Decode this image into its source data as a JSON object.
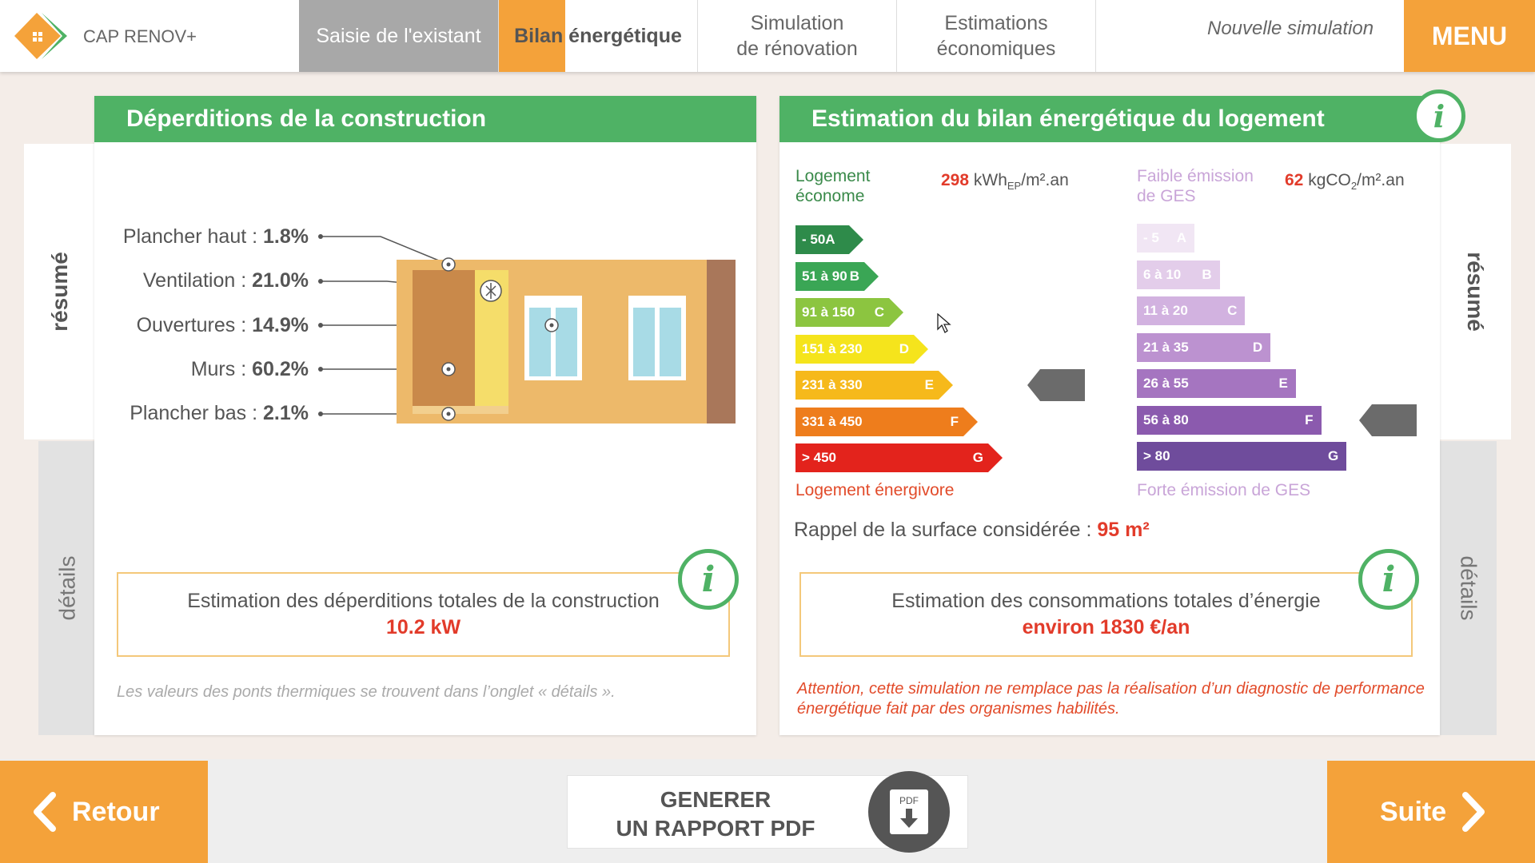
{
  "header": {
    "app_name": "CAP RENOV+",
    "tabs": [
      {
        "label": "Saisie de l'existant"
      },
      {
        "label_highlight": "Bilan",
        "label_rest": " énergétique"
      },
      {
        "line1": "Simulation",
        "line2": "de rénovation"
      },
      {
        "line1": "Estimations",
        "line2": "économiques"
      }
    ],
    "new_simulation": "Nouvelle simulation",
    "menu_label": "MENU"
  },
  "left_panel": {
    "title": "Déperditions de la construction",
    "side_tab_top": "résumé",
    "side_tab_bottom": "détails",
    "losses": [
      {
        "name": "Plancher haut : ",
        "value": "1.8%"
      },
      {
        "name": "Ventilation : ",
        "value": "21.0%"
      },
      {
        "name": "Ouvertures : ",
        "value": "14.9%"
      },
      {
        "name": "Murs : ",
        "value": "60.2%"
      },
      {
        "name": "Plancher bas : ",
        "value": "2.1%"
      }
    ],
    "total_label": "Estimation des déperditions totales de la construction",
    "total_value": "10.2 kW",
    "note": "Les valeurs des ponts thermiques se trouvent dans l’onglet « détails »."
  },
  "right_panel": {
    "title": "Estimation du bilan énergétique du logement",
    "side_tab_top": "résumé",
    "side_tab_bottom": "détails",
    "econome_line1": "Logement",
    "econome_line2": "économe",
    "energy_value": "298",
    "energy_unit_a": " kWh",
    "energy_unit_sub": "EP",
    "energy_unit_b": "/m².an",
    "faible_line1": "Faible émission",
    "faible_line2": "de GES",
    "ges_value": "62",
    "ges_unit_a": " kgCO",
    "ges_unit_sub": "2",
    "ges_unit_b": "/m².an",
    "energy_classes": [
      {
        "range": "- 50",
        "letter": "A",
        "color": "#2e8b4a"
      },
      {
        "range": "51 à 90",
        "letter": "B",
        "color": "#3aa655"
      },
      {
        "range": "91 à 150",
        "letter": "C",
        "color": "#8cc540"
      },
      {
        "range": "151 à 230",
        "letter": "D",
        "color": "#f5e41c"
      },
      {
        "range": "231 à 330",
        "letter": "E",
        "color": "#f6b91b"
      },
      {
        "range": "331 à 450",
        "letter": "F",
        "color": "#ee7d1c"
      },
      {
        "range": "> 450",
        "letter": "G",
        "color": "#e3231c"
      }
    ],
    "energy_class_index": 4,
    "ges_classes": [
      {
        "range": "- 5",
        "letter": "A",
        "color": "#f1e6f4"
      },
      {
        "range": "6 à 10",
        "letter": "B",
        "color": "#e3cdea"
      },
      {
        "range": "11 à 20",
        "letter": "C",
        "color": "#d2b2e0"
      },
      {
        "range": "21 à 35",
        "letter": "D",
        "color": "#bc92d0"
      },
      {
        "range": "26 à 55",
        "letter": "E",
        "color": "#a575c0"
      },
      {
        "range": "56 à 80",
        "letter": "F",
        "color": "#8b5aae"
      },
      {
        "range": "> 80",
        "letter": "G",
        "color": "#6f4c9c"
      }
    ],
    "ges_class_index": 5,
    "energivore": "Logement énergivore",
    "forte": "Forte émission de GES",
    "surface_label": "Rappel de la surface considérée : ",
    "surface_value": "95 m²",
    "total_label": "Estimation des consommations totales d’énergie",
    "total_value": "environ 1830 €/an",
    "warning": "Attention, cette simulation ne remplace pas la réalisation d’un diagnostic de performance énergétique fait par des organismes habilités."
  },
  "info_icon_glyph": "i",
  "footer": {
    "back_label": "Retour",
    "next_label": "Suite",
    "pdf_line1": "GENERER",
    "pdf_line2": "UN RAPPORT PDF",
    "pdf_icon_text": "PDF"
  },
  "colors": {
    "accent_orange": "#f4a23a",
    "header_green": "#4fb265",
    "value_red": "#e23b2a"
  }
}
